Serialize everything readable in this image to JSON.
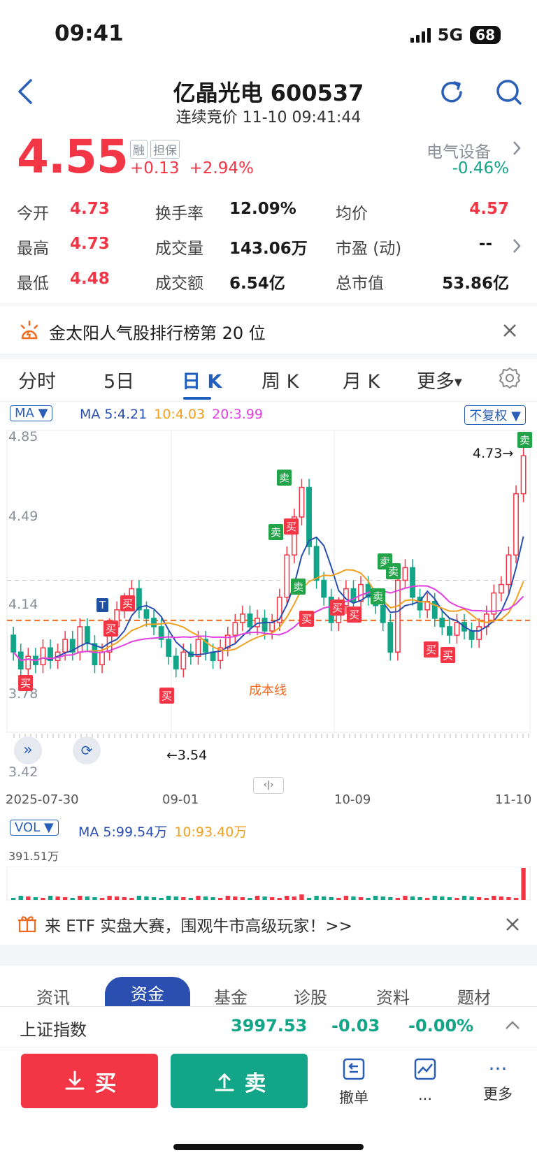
{
  "status": {
    "time": "09:41",
    "network": "5G",
    "battery": "68"
  },
  "header": {
    "title": "亿晶光电 600537",
    "subtitle": "连续竞价 11-10 09:41:44"
  },
  "quote": {
    "price": "4.55",
    "tag_margin": "融",
    "tag_pledge": "担保",
    "change": "+0.13",
    "change_pct": "+2.94%",
    "sector": "电气设备",
    "sector_chg": "-0.46%"
  },
  "stats": [
    {
      "label": "今开",
      "value": "4.73"
    },
    {
      "label": "换手率",
      "value": "12.09%"
    },
    {
      "label": "均价",
      "value": "4.57"
    },
    {
      "label": "最高",
      "value": "4.73"
    },
    {
      "label": "成交量",
      "value": "143.06万"
    },
    {
      "label": "市盈 (动)",
      "value": "--"
    },
    {
      "label": "最低",
      "value": "4.48"
    },
    {
      "label": "成交额",
      "value": "6.54亿"
    },
    {
      "label": "总市值",
      "value": "53.86亿"
    }
  ],
  "banner": {
    "text": "金太阳人气股排行榜第 20 位"
  },
  "periods": [
    "分时",
    "5日",
    "日 K",
    "周 K",
    "月 K",
    "更多"
  ],
  "chart": {
    "ma_button": "MA",
    "ma5": "MA 5:4.21",
    "ma10": "10:4.03",
    "ma20": "20:3.99",
    "adjust_button": "不复权",
    "y_labels": [
      "4.85",
      "4.49",
      "4.14",
      "3.78",
      "3.42"
    ],
    "dates": [
      "2025-07-30",
      "09-01",
      "10-09",
      "11-10"
    ],
    "high_mark": "4.73",
    "low_mark": "3.54",
    "cost_line": "成本线",
    "buy": "买",
    "sell": "卖",
    "t_mark": "T",
    "vol_button": "VOL",
    "vol_ma5": "MA 5:99.54万",
    "vol_ma10": "10:93.40万",
    "vol_max": "391.51万",
    "colors": {
      "up": "#f23645",
      "down": "#12a587",
      "ma5": "#2a4fb0",
      "ma10": "#f0a020",
      "ma20": "#e040e0"
    }
  },
  "chart_data": {
    "type": "candlestick",
    "ylim": [
      3.42,
      4.85
    ],
    "cost_line": 3.95,
    "candles": [
      [
        3.88,
        3.8
      ],
      [
        3.8,
        3.72
      ],
      [
        3.72,
        3.78
      ],
      [
        3.78,
        3.74
      ],
      [
        3.74,
        3.82
      ],
      [
        3.82,
        3.76
      ],
      [
        3.76,
        3.8
      ],
      [
        3.8,
        3.86
      ],
      [
        3.86,
        3.8
      ],
      [
        3.8,
        3.92
      ],
      [
        3.92,
        3.84
      ],
      [
        3.84,
        3.74
      ],
      [
        3.74,
        3.8
      ],
      [
        3.8,
        3.92
      ],
      [
        3.92,
        4.0
      ],
      [
        4.0,
        4.04
      ],
      [
        4.04,
        4.1
      ],
      [
        4.1,
        4.0
      ],
      [
        4.0,
        3.96
      ],
      [
        3.96,
        3.92
      ],
      [
        3.92,
        3.86
      ],
      [
        3.86,
        3.78
      ],
      [
        3.78,
        3.72
      ],
      [
        3.72,
        3.8
      ],
      [
        3.8,
        3.78
      ],
      [
        3.78,
        3.86
      ],
      [
        3.86,
        3.8
      ],
      [
        3.8,
        3.76
      ],
      [
        3.76,
        3.82
      ],
      [
        3.82,
        3.88
      ],
      [
        3.88,
        3.94
      ],
      [
        3.94,
        3.98
      ],
      [
        3.98,
        3.92
      ],
      [
        3.92,
        3.96
      ],
      [
        3.96,
        3.9
      ],
      [
        3.9,
        3.94
      ],
      [
        3.94,
        4.06
      ],
      [
        4.06,
        4.26
      ],
      [
        4.26,
        4.44
      ],
      [
        4.44,
        4.58
      ],
      [
        4.58,
        4.3
      ],
      [
        4.3,
        4.14
      ],
      [
        4.14,
        4.06
      ],
      [
        4.06,
        3.94
      ],
      [
        3.94,
        4.02
      ],
      [
        4.02,
        4.1
      ],
      [
        4.1,
        4.04
      ],
      [
        4.04,
        4.12
      ],
      [
        4.12,
        4.06
      ],
      [
        4.06,
        4.02
      ],
      [
        4.02,
        3.94
      ],
      [
        3.94,
        3.8
      ],
      [
        3.8,
        4.14
      ],
      [
        4.14,
        4.2
      ],
      [
        4.2,
        4.06
      ],
      [
        4.06,
        4.0
      ],
      [
        4.0,
        4.04
      ],
      [
        4.04,
        3.96
      ],
      [
        3.96,
        3.92
      ],
      [
        3.92,
        3.88
      ],
      [
        3.88,
        3.94
      ],
      [
        3.94,
        3.9
      ],
      [
        3.9,
        3.86
      ],
      [
        3.86,
        3.92
      ],
      [
        3.92,
        3.98
      ],
      [
        3.98,
        4.08
      ],
      [
        4.08,
        4.12
      ],
      [
        4.12,
        4.26
      ],
      [
        4.26,
        4.55
      ],
      [
        4.55,
        4.73
      ]
    ],
    "x": [
      "2025-07-30",
      "09-01",
      "10-09",
      "11-10"
    ],
    "title": "",
    "xlabel": "",
    "ylabel": ""
  },
  "promo": {
    "text": "来 ETF 实盘大赛，围观牛市高级玩家！>>"
  },
  "feature_tabs": [
    "资讯",
    "资金",
    "基金",
    "诊股",
    "资料",
    "题材"
  ],
  "index": {
    "name": "上证指数",
    "value": "3997.53",
    "chg": "-0.03",
    "pct": "-0.00%"
  },
  "bottom": {
    "buy": "买",
    "sell": "卖",
    "cancel": "撤单",
    "dots": "...",
    "more": "更多"
  }
}
